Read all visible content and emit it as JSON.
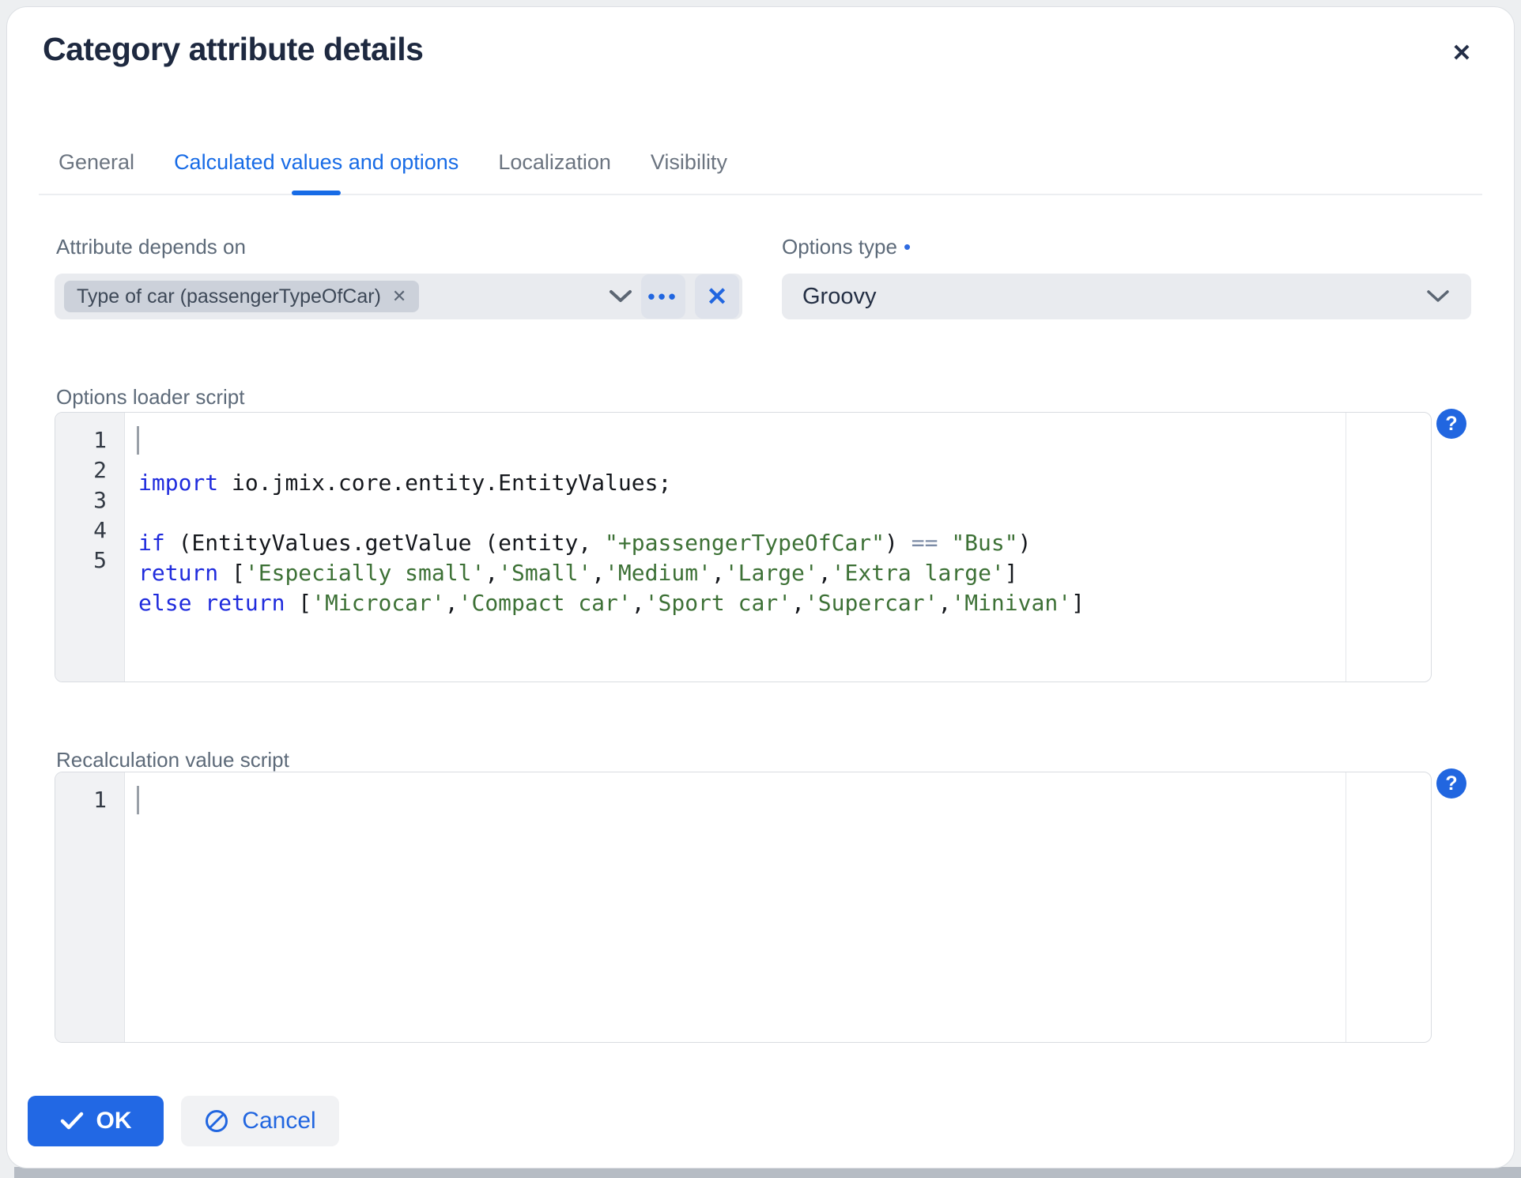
{
  "dialog": {
    "title": "Category attribute details",
    "close_glyph": "✕"
  },
  "tabs": [
    {
      "label": "General"
    },
    {
      "label": "Calculated values and options"
    },
    {
      "label": "Localization"
    },
    {
      "label": "Visibility"
    }
  ],
  "form": {
    "attribute_depends_on": {
      "label": "Attribute depends on",
      "chip": "Type of car (passengerTypeOfCar)",
      "chip_remove_glyph": "✕",
      "dots_glyph": "•••",
      "clear_glyph": "✕"
    },
    "options_type": {
      "label": "Options type",
      "required_glyph": "•",
      "value": "Groovy"
    }
  },
  "options_loader": {
    "label": "Options loader script",
    "help_glyph": "?",
    "lines": [
      {
        "num": "1",
        "tokens": [
          {
            "t": "kw",
            "v": "import"
          },
          {
            "t": "p",
            "v": " io.jmix.core.entity.EntityValues;"
          }
        ]
      },
      {
        "num": "2",
        "tokens": []
      },
      {
        "num": "3",
        "tokens": [
          {
            "t": "kw",
            "v": "if"
          },
          {
            "t": "p",
            "v": " (EntityValues.getValue (entity, "
          },
          {
            "t": "s",
            "v": "\"+passengerTypeOfCar\""
          },
          {
            "t": "p",
            "v": ") "
          },
          {
            "t": "op",
            "v": "=="
          },
          {
            "t": "p",
            "v": " "
          },
          {
            "t": "s",
            "v": "\"Bus\""
          },
          {
            "t": "p",
            "v": ")"
          }
        ]
      },
      {
        "num": "4",
        "tokens": [
          {
            "t": "kw",
            "v": "return"
          },
          {
            "t": "p",
            "v": " ["
          },
          {
            "t": "s",
            "v": "'Especially small'"
          },
          {
            "t": "p",
            "v": ","
          },
          {
            "t": "s",
            "v": "'Small'"
          },
          {
            "t": "p",
            "v": ","
          },
          {
            "t": "s",
            "v": "'Medium'"
          },
          {
            "t": "p",
            "v": ","
          },
          {
            "t": "s",
            "v": "'Large'"
          },
          {
            "t": "p",
            "v": ","
          },
          {
            "t": "s",
            "v": "'Extra large'"
          },
          {
            "t": "p",
            "v": "]"
          }
        ]
      },
      {
        "num": "5",
        "tokens": [
          {
            "t": "kw",
            "v": "else"
          },
          {
            "t": "p",
            "v": " "
          },
          {
            "t": "kw",
            "v": "return"
          },
          {
            "t": "p",
            "v": " ["
          },
          {
            "t": "s",
            "v": "'Microcar'"
          },
          {
            "t": "p",
            "v": ","
          },
          {
            "t": "s",
            "v": "'Compact car'"
          },
          {
            "t": "p",
            "v": ","
          },
          {
            "t": "s",
            "v": "'Sport car'"
          },
          {
            "t": "p",
            "v": ","
          },
          {
            "t": "s",
            "v": "'Supercar'"
          },
          {
            "t": "p",
            "v": ","
          },
          {
            "t": "s",
            "v": "'Minivan'"
          },
          {
            "t": "p",
            "v": "]"
          }
        ]
      }
    ]
  },
  "recalculation": {
    "label": "Recalculation value script",
    "help_glyph": "?",
    "lines": [
      {
        "num": "1",
        "tokens": []
      }
    ]
  },
  "buttons": {
    "ok": "OK",
    "cancel": "Cancel"
  },
  "colors": {
    "accent_blue": "#2166e0",
    "tab_active": "#176be6",
    "ok_button": "#2268e4",
    "keyword": "#1f2bdd",
    "string": "#3d7136",
    "field_bg": "#e9ebef",
    "chip_bg": "#ccd1da",
    "title_text": "#1e2940"
  }
}
